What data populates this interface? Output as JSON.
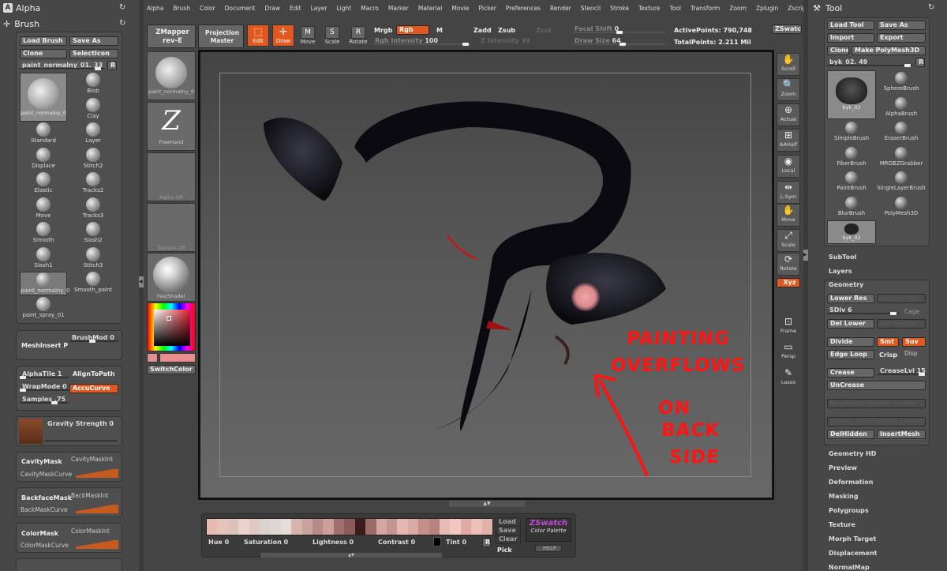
{
  "left": {
    "alpha_title": "Alpha",
    "brush_title": "Brush",
    "buttons": {
      "load": "Load Brush",
      "save": "Save As",
      "clone": "Clone",
      "select_icon": "SelectIcon",
      "r": "R"
    },
    "current": {
      "name": "paint_normalny_01.",
      "value": "33",
      "thumb": "paint_normalny_0"
    },
    "brushes": [
      "Blob",
      "Clay",
      "Standard",
      "Layer",
      "Displace",
      "Stitch2",
      "Elastic",
      "Tracks2",
      "Move",
      "Tracks3",
      "Smooth",
      "Slash2",
      "Slash1",
      "Stitch3",
      "paint_normalny_0",
      "Smooth_paint",
      "paint_spray_01"
    ],
    "meshinsert": "MeshInsert P",
    "brushmod": "BrushMod",
    "brushmod_val": "0",
    "alphatile": "AlphaTile",
    "alphatile_val": "1",
    "aligntopath": "AlignToPath",
    "wrapmode": "WrapMode",
    "wrapmode_val": "0",
    "accucurve": "AccuCurve",
    "samples": "Samples",
    "samples_val": ".75",
    "gravity": "Gravity Strength",
    "gravity_val": "0",
    "cavitymask": "CavityMask",
    "cavitymaskint": "CavityMaskInt",
    "cavitymaskcurve": "CavityMaskCurve",
    "backfacemask": "BackfaceMask",
    "backmaskint": "BackMaskInt",
    "backmaskcurve": "BackMaskCurve",
    "colormask": "ColorMask",
    "colormaskint": "ColorMaskInt",
    "colormaskcurve": "ColorMaskCurve"
  },
  "menu": [
    "Alpha",
    "Brush",
    "Color",
    "Document",
    "Draw",
    "Edit",
    "Layer",
    "Light",
    "Macro",
    "Marker",
    "Material",
    "Movie",
    "Picker",
    "Preferences",
    "Render",
    "Stencil",
    "Stroke",
    "Texture",
    "Tool",
    "Transform",
    "Zoom",
    "Zplugin",
    "Zscript"
  ],
  "toolbar": {
    "zmapper": "ZMapper",
    "zmapper2": "rev-E",
    "projection": "Projection",
    "projection2": "Master",
    "edit": "Edit",
    "draw": "Draw",
    "move": "Move",
    "scale": "Scale",
    "rotate": "Rotate",
    "mrgb": "Mrgb",
    "rgb": "Rgb",
    "m": "M",
    "rgb_intensity": "Rgb Intensity",
    "rgb_intensity_val": "100",
    "zadd": "Zadd",
    "zsub": "Zsub",
    "zcut": "Zcut",
    "z_intensity": "Z Intensity",
    "z_intensity_val": "39",
    "focal_shift": "Focal Shift",
    "focal_shift_val": "0",
    "draw_size": "Draw Size",
    "draw_size_val": "64",
    "active_points": "ActivePoints:",
    "active_points_val": "790,748",
    "total_points": "TotalPoints:",
    "total_points_val": "2.211 Mil",
    "zswatch": "ZSwatch"
  },
  "shelf": {
    "thumb1": "paint_normalny_0",
    "freehand": "FreeHand",
    "alpha_off": "Alpha Off",
    "texture_off": "Texture Off",
    "fastshader": "FastShader",
    "switchcolor": "SwitchColor"
  },
  "righttools": [
    "Scroll",
    "Zoom",
    "Actual",
    "AAHalf",
    "Local",
    "L.Sym",
    "Move",
    "Scale",
    "Rotate",
    "Xyz",
    "Frame",
    "Persp",
    "Lasso"
  ],
  "annotation": {
    "line1": "PAINTING",
    "line2": "OVERFLOWS",
    "line3": "ON",
    "line4": "BACK",
    "line5": "SIDE"
  },
  "palette": {
    "hue": "Hue",
    "hue_val": "0",
    "saturation": "Saturation",
    "saturation_val": "0",
    "lightness": "Lightness",
    "lightness_val": "0",
    "contrast": "Contrast",
    "contrast_val": "0",
    "tint": "Tint",
    "tint_val": "0",
    "load": "Load",
    "save": "Save",
    "clear": "Clear",
    "pick": "Pick",
    "zswatch": "ZSwatch",
    "color_palette": "Color Palette",
    "help": "HELP",
    "r": "R",
    "swatches": [
      "#e8b9b0",
      "#e6c3bb",
      "#dcc2bc",
      "#ecd2cc",
      "#e2c8c3",
      "#d9d3d0",
      "#ddd6d2",
      "#e5dcd8",
      "#d7b4ae",
      "#c8a29d",
      "#b78b88",
      "#cf9e98",
      "#a0706e",
      "#8c5b5a",
      "#3b1d1e",
      "#9a6b69",
      "#d5a5a0",
      "#c39592",
      "#e2b6b1",
      "#d9a9a5",
      "#c48f8a",
      "#b78380",
      "#e5bcb5",
      "#f0c8c1",
      "#deaaa4",
      "#ecc0b9",
      "#e0b3ad"
    ]
  },
  "right": {
    "title": "Tool",
    "load": "Load Tool",
    "save": "Save As",
    "import": "Import",
    "export": "Export",
    "clone": "Clone",
    "make": "Make PolyMesh3D",
    "current": "byk_02.",
    "current_val": "49",
    "r": "R",
    "thumb": "byk_02",
    "tools": [
      "SphereBrush",
      "AlphaBrush",
      "SimpleBrush",
      "EraserBrush",
      "FiberBrush",
      "MRGBZGrabber",
      "PaintBrush",
      "SingleLayerBrush",
      "BlurBrush",
      "PolyMesh3D"
    ],
    "thumb2": "byk_02",
    "subtool": "SubTool",
    "layers": "Layers",
    "geometry": "Geometry",
    "lower_res": "Lower Res",
    "higher_res": "Higher Res",
    "sdiv": "SDiv",
    "sdiv_val": "6",
    "cage": "Cage",
    "del_lower": "Del Lower",
    "del_higher": "Del Higher",
    "divide": "Divide",
    "smt": "Smt",
    "suv": "Suv",
    "edge_loop": "Edge Loop",
    "crisp": "Crisp",
    "disp": "Disp",
    "crease": "Crease",
    "creaselvl": "CreaseLvl",
    "creaselvl_val": "15",
    "uncrease": "UnCrease",
    "reproject": "Reproject Higher Subdiv",
    "freeze": "Freeze SubDivision Levels",
    "delhidden": "DelHidden",
    "insertmesh": "InsertMesh",
    "sections": [
      "Geometry HD",
      "Preview",
      "Deformation",
      "Masking",
      "Polygroups",
      "Texture",
      "Morph Target",
      "Displacement",
      "NormalMap"
    ]
  }
}
